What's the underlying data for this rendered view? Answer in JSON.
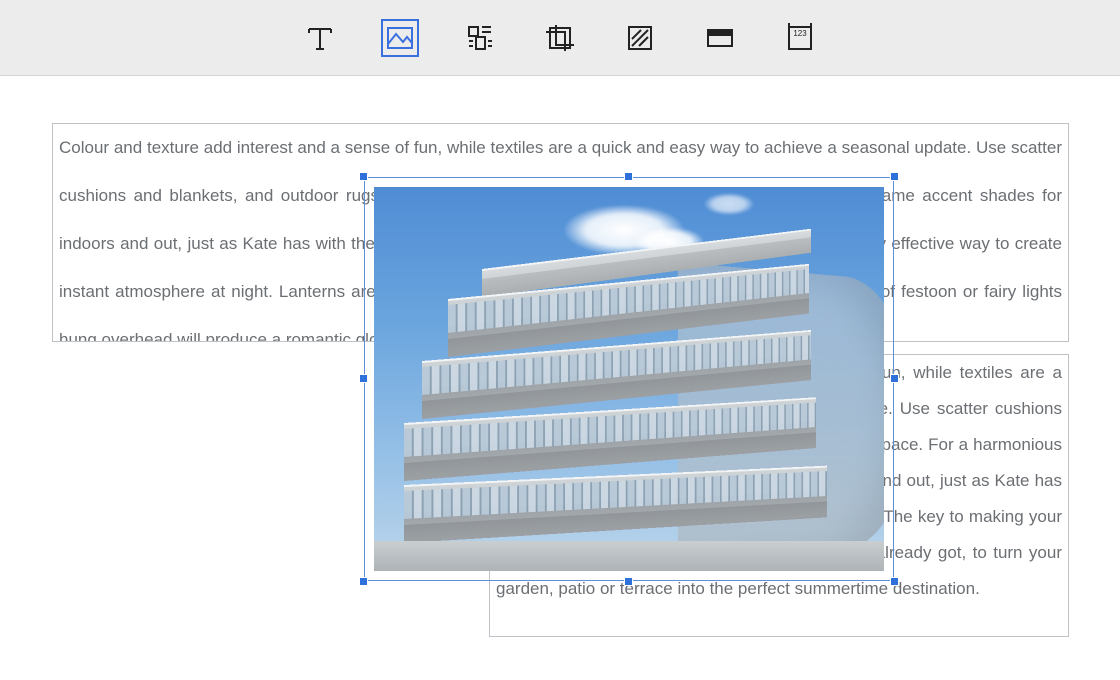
{
  "toolbar": {
    "items": [
      {
        "name": "text-tool",
        "icon": "text-icon",
        "active": false
      },
      {
        "name": "place-image-tool",
        "icon": "image-icon",
        "active": true
      },
      {
        "name": "text-wrap-tool",
        "icon": "wrap-icon",
        "active": false
      },
      {
        "name": "crop-tool",
        "icon": "crop-icon",
        "active": false
      },
      {
        "name": "fill-tool",
        "icon": "fill-icon",
        "active": false
      },
      {
        "name": "frame-tool",
        "icon": "frame-icon",
        "active": false
      },
      {
        "name": "frame-options-tool",
        "icon": "frame-num-icon",
        "active": false
      }
    ]
  },
  "textFrames": {
    "frame1": "Colour and texture add interest and a sense of fun, while textiles are a quick and easy way to achieve a seasonal update. Use scatter cushions and blankets, and outdoor rugs to help define the space. For a harmonious look, choose the same accent shades for indoors and out, just as Kate has with the purple and lime tones seen in her kitchen. Finally, lighting is a very effective way to create instant atmosphere at night. Lanterns are the simplest option and come in  a variety of styles, while strings of festoon or fairy lights hung overhead will produce a romantic glow.",
    "frame2": "Colour and texture add interest and a sense of fun, while textiles are a quick and easy way to achieve a seasonal update. Use scatter cushions and blankets, and outdoor rugs to help define the space. For a harmonious look, choose the same accent shades for indoors and out, just as Kate has with the purple and lime tones seen in her kitchen. The key to making your home summer-ready is to maximise what you've already got, to turn your garden, patio or terrace into the perfect summertime destination."
  },
  "selection": {
    "object": "placed-image",
    "handles": [
      "tl",
      "tm",
      "tr",
      "ml",
      "mr",
      "bl",
      "bm",
      "br"
    ]
  }
}
